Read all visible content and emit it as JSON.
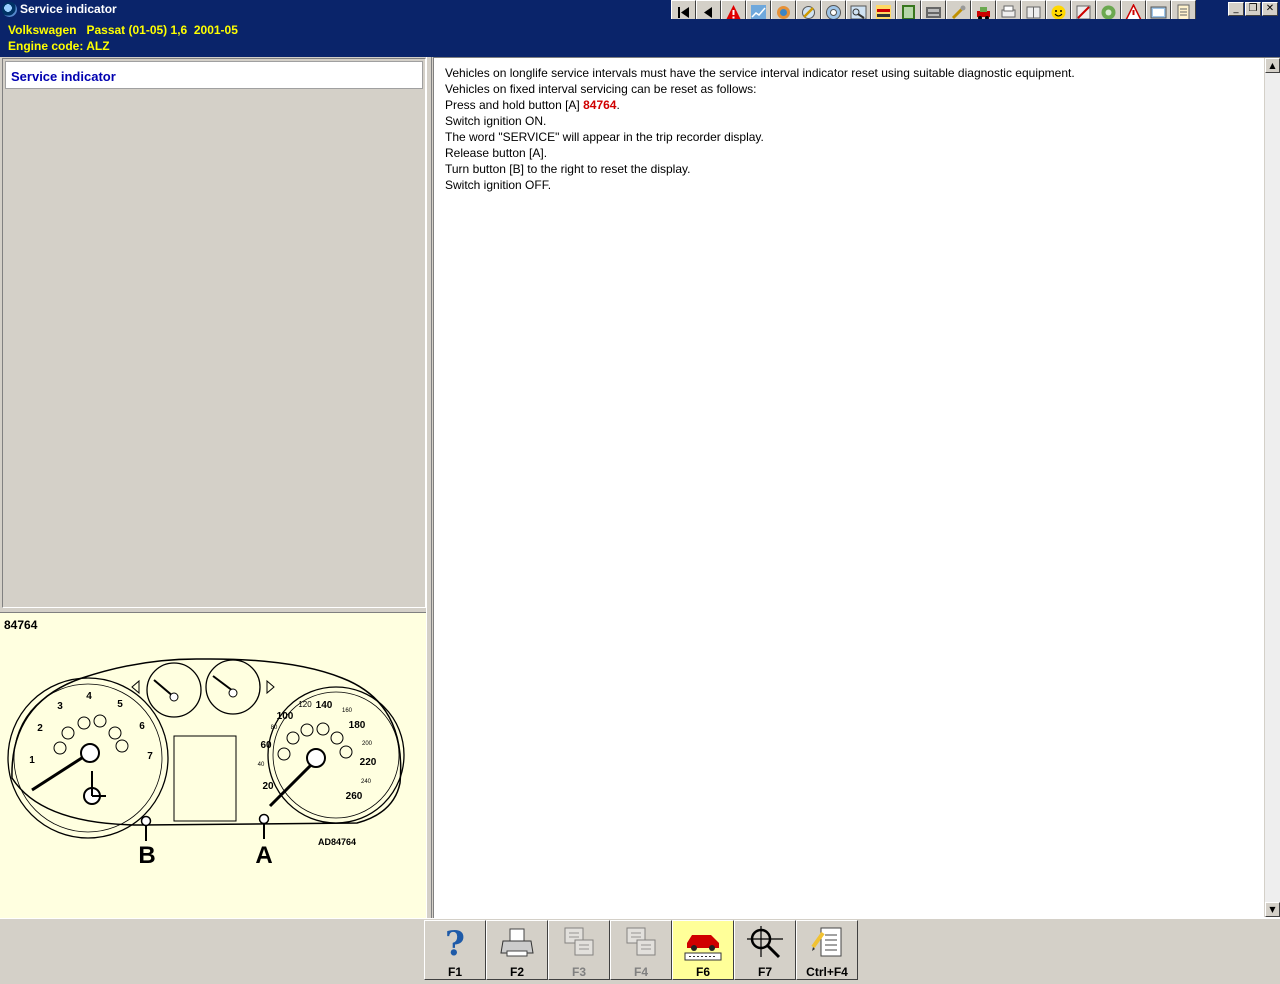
{
  "window": {
    "title": "Service indicator"
  },
  "vehicle": {
    "line1": "Volkswagen   Passat (01-05) 1,6  2001-05",
    "line2": "Engine code: ALZ"
  },
  "toolbar": {
    "icons": [
      "first-icon",
      "back-icon",
      "warning-icon",
      "chart-icon",
      "gear-icon",
      "wrench-icon",
      "disc-icon",
      "tool-icon",
      "arrows-icon",
      "panel-icon",
      "engine-icon",
      "spanner-icon",
      "vehicle-icon",
      "printer-icon",
      "manual-icon",
      "smile-icon",
      "stop-icon",
      "help-icon",
      "alert-icon",
      "info-icon",
      "notes-icon"
    ]
  },
  "window_controls": {
    "minimize": "_",
    "restore": "❐",
    "close": "✕"
  },
  "nav": {
    "selected": "Service indicator"
  },
  "diagram": {
    "id": "84764",
    "callout_b": "B",
    "callout_a": "A",
    "ref": "AD84764",
    "tach": [
      "1",
      "2",
      "3",
      "4",
      "5",
      "6",
      "7"
    ],
    "speedo": [
      "20",
      "40",
      "60",
      "80",
      "100",
      "120",
      "140",
      "160",
      "180",
      "200",
      "220",
      "240",
      "260"
    ]
  },
  "content": {
    "line1": "Vehicles on longlife service intervals must have the service interval indicator reset using suitable diagnostic equipment.",
    "line2": "Vehicles on fixed interval servicing can be reset as follows:",
    "line3_pre": "Press and hold button [A] ",
    "line3_ref": "84764",
    "line3_post": ".",
    "line4": "Switch ignition ON.",
    "line5": "The word \"SERVICE\" will appear in the trip recorder display.",
    "line6": "Release button [A].",
    "line7": "Turn button [B] to the right to reset the display.",
    "line8": "Switch ignition OFF."
  },
  "fkeys": [
    {
      "label": "F1",
      "icon": "help-question-icon"
    },
    {
      "label": "F2",
      "icon": "printer-icon"
    },
    {
      "label": "F3",
      "icon": "copy-pages-icon"
    },
    {
      "label": "F4",
      "icon": "copy-pages-icon"
    },
    {
      "label": "F6",
      "icon": "car-odometer-icon"
    },
    {
      "label": "F7",
      "icon": "magnifier-icon"
    },
    {
      "label": "Ctrl+F4",
      "icon": "notes-icon"
    }
  ]
}
